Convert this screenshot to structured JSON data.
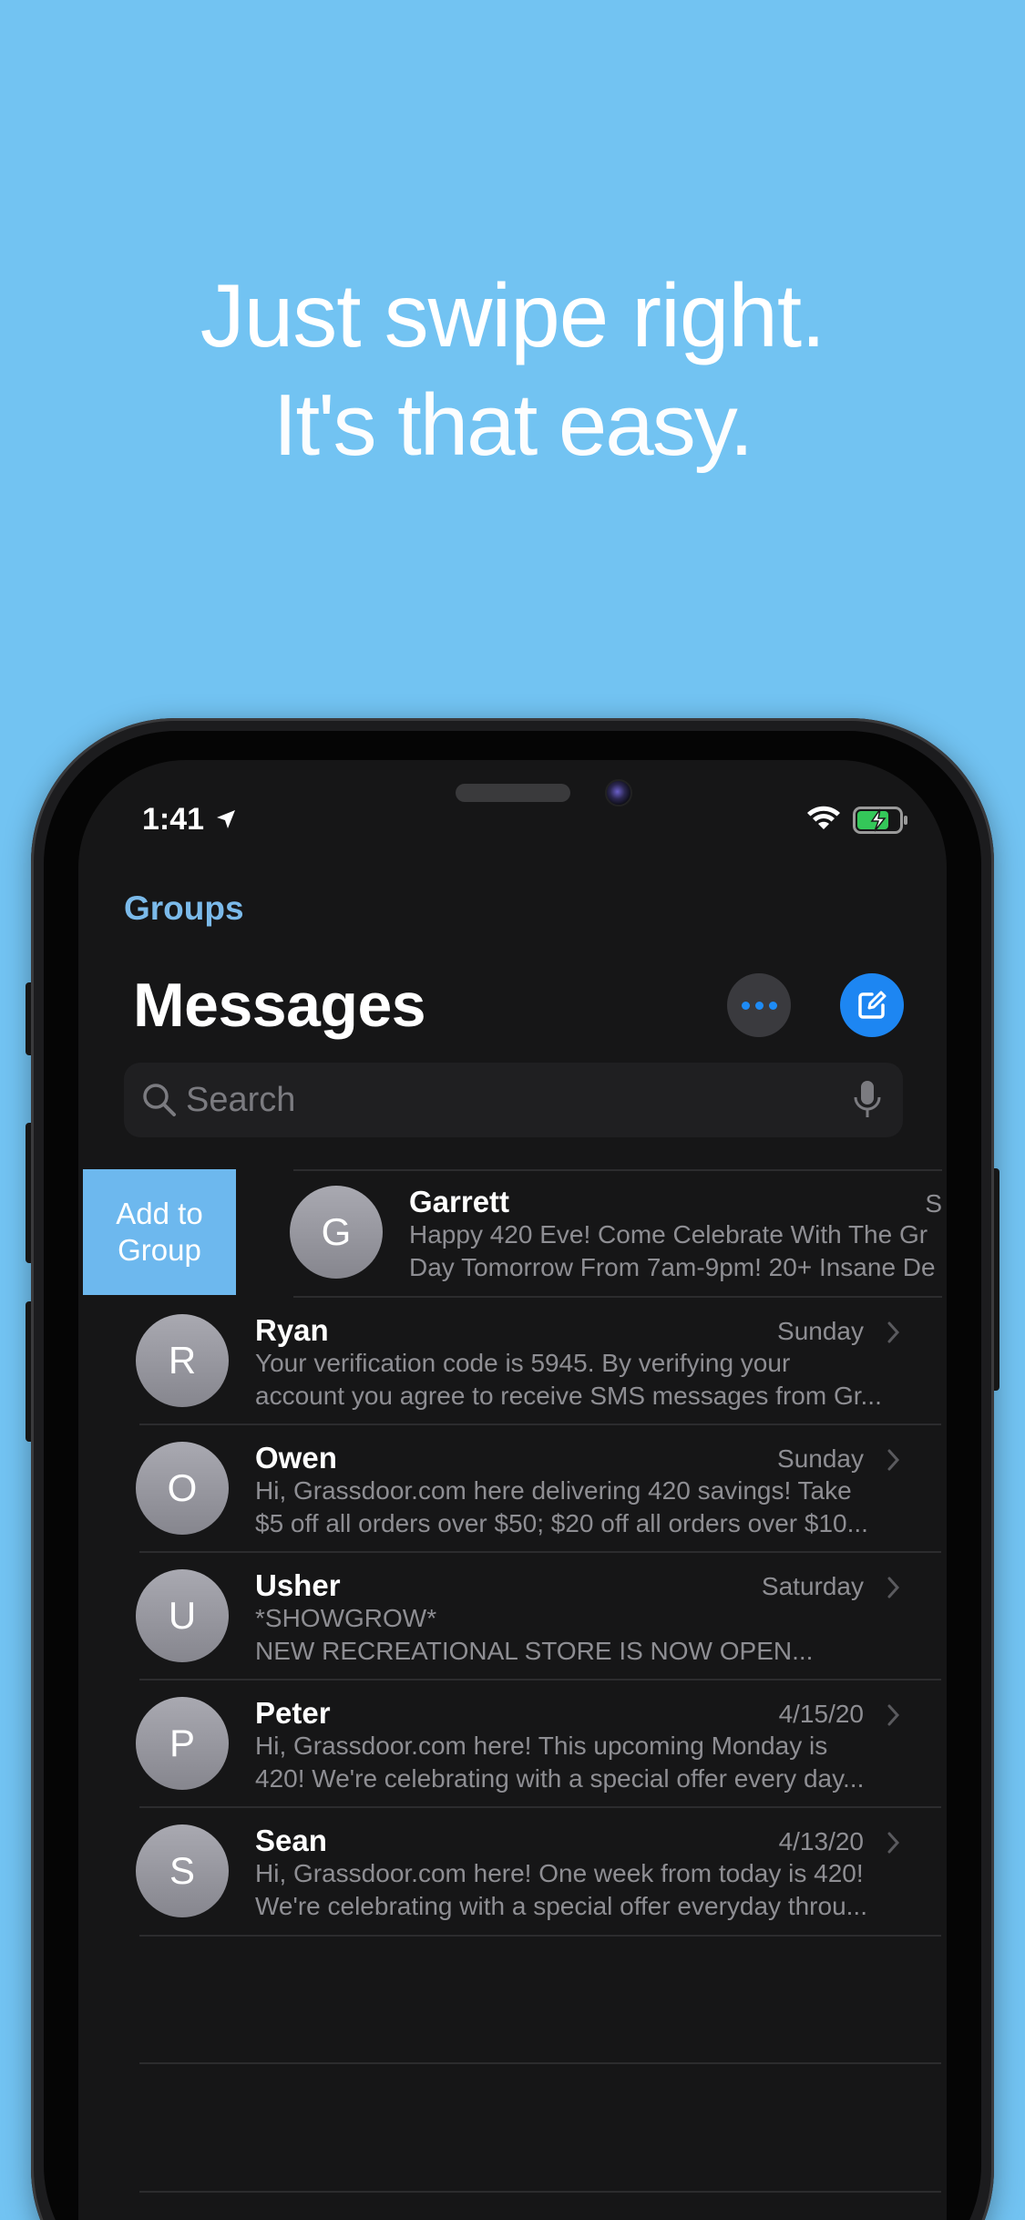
{
  "promo": {
    "headline": "Just swipe right.",
    "subheadline": "It's that easy."
  },
  "status_bar": {
    "time": "1:41"
  },
  "nav": {
    "back_label": "Groups",
    "title": "Messages"
  },
  "search": {
    "placeholder": "Search"
  },
  "swipe_action": {
    "label_line1": "Add to",
    "label_line2": "Group"
  },
  "conversations": [
    {
      "initial": "G",
      "name": "Garrett",
      "date": "S",
      "preview_line1": "Happy 420 Eve! Come Celebrate With The Gr",
      "preview_line2": "Day Tomorrow From 7am-9pm! 20+ Insane De"
    },
    {
      "initial": "R",
      "name": "Ryan",
      "date": "Sunday",
      "preview_line1": "Your verification code is 5945. By verifying your",
      "preview_line2": "account you agree to receive SMS messages from Gr..."
    },
    {
      "initial": "O",
      "name": "Owen",
      "date": "Sunday",
      "preview_line1": "Hi, Grassdoor.com here delivering 420 savings! Take",
      "preview_line2": "$5 off all orders over $50; $20 off all orders over $10..."
    },
    {
      "initial": "U",
      "name": "Usher",
      "date": "Saturday",
      "preview_line1": "*SHOWGROW*",
      "preview_line2": "NEW RECREATIONAL STORE IS NOW OPEN..."
    },
    {
      "initial": "P",
      "name": "Peter",
      "date": "4/15/20",
      "preview_line1": "Hi, Grassdoor.com here! This upcoming Monday is",
      "preview_line2": "420! We're celebrating with a special offer every day..."
    },
    {
      "initial": "S",
      "name": "Sean",
      "date": "4/13/20",
      "preview_line1": "Hi, Grassdoor.com here! One week from today is 420!",
      "preview_line2": "We're celebrating with a special offer everyday throu..."
    }
  ],
  "colors": {
    "background": "#72C3F2",
    "accent": "#1D86F2",
    "swipe_action": "#6DB8EE"
  }
}
